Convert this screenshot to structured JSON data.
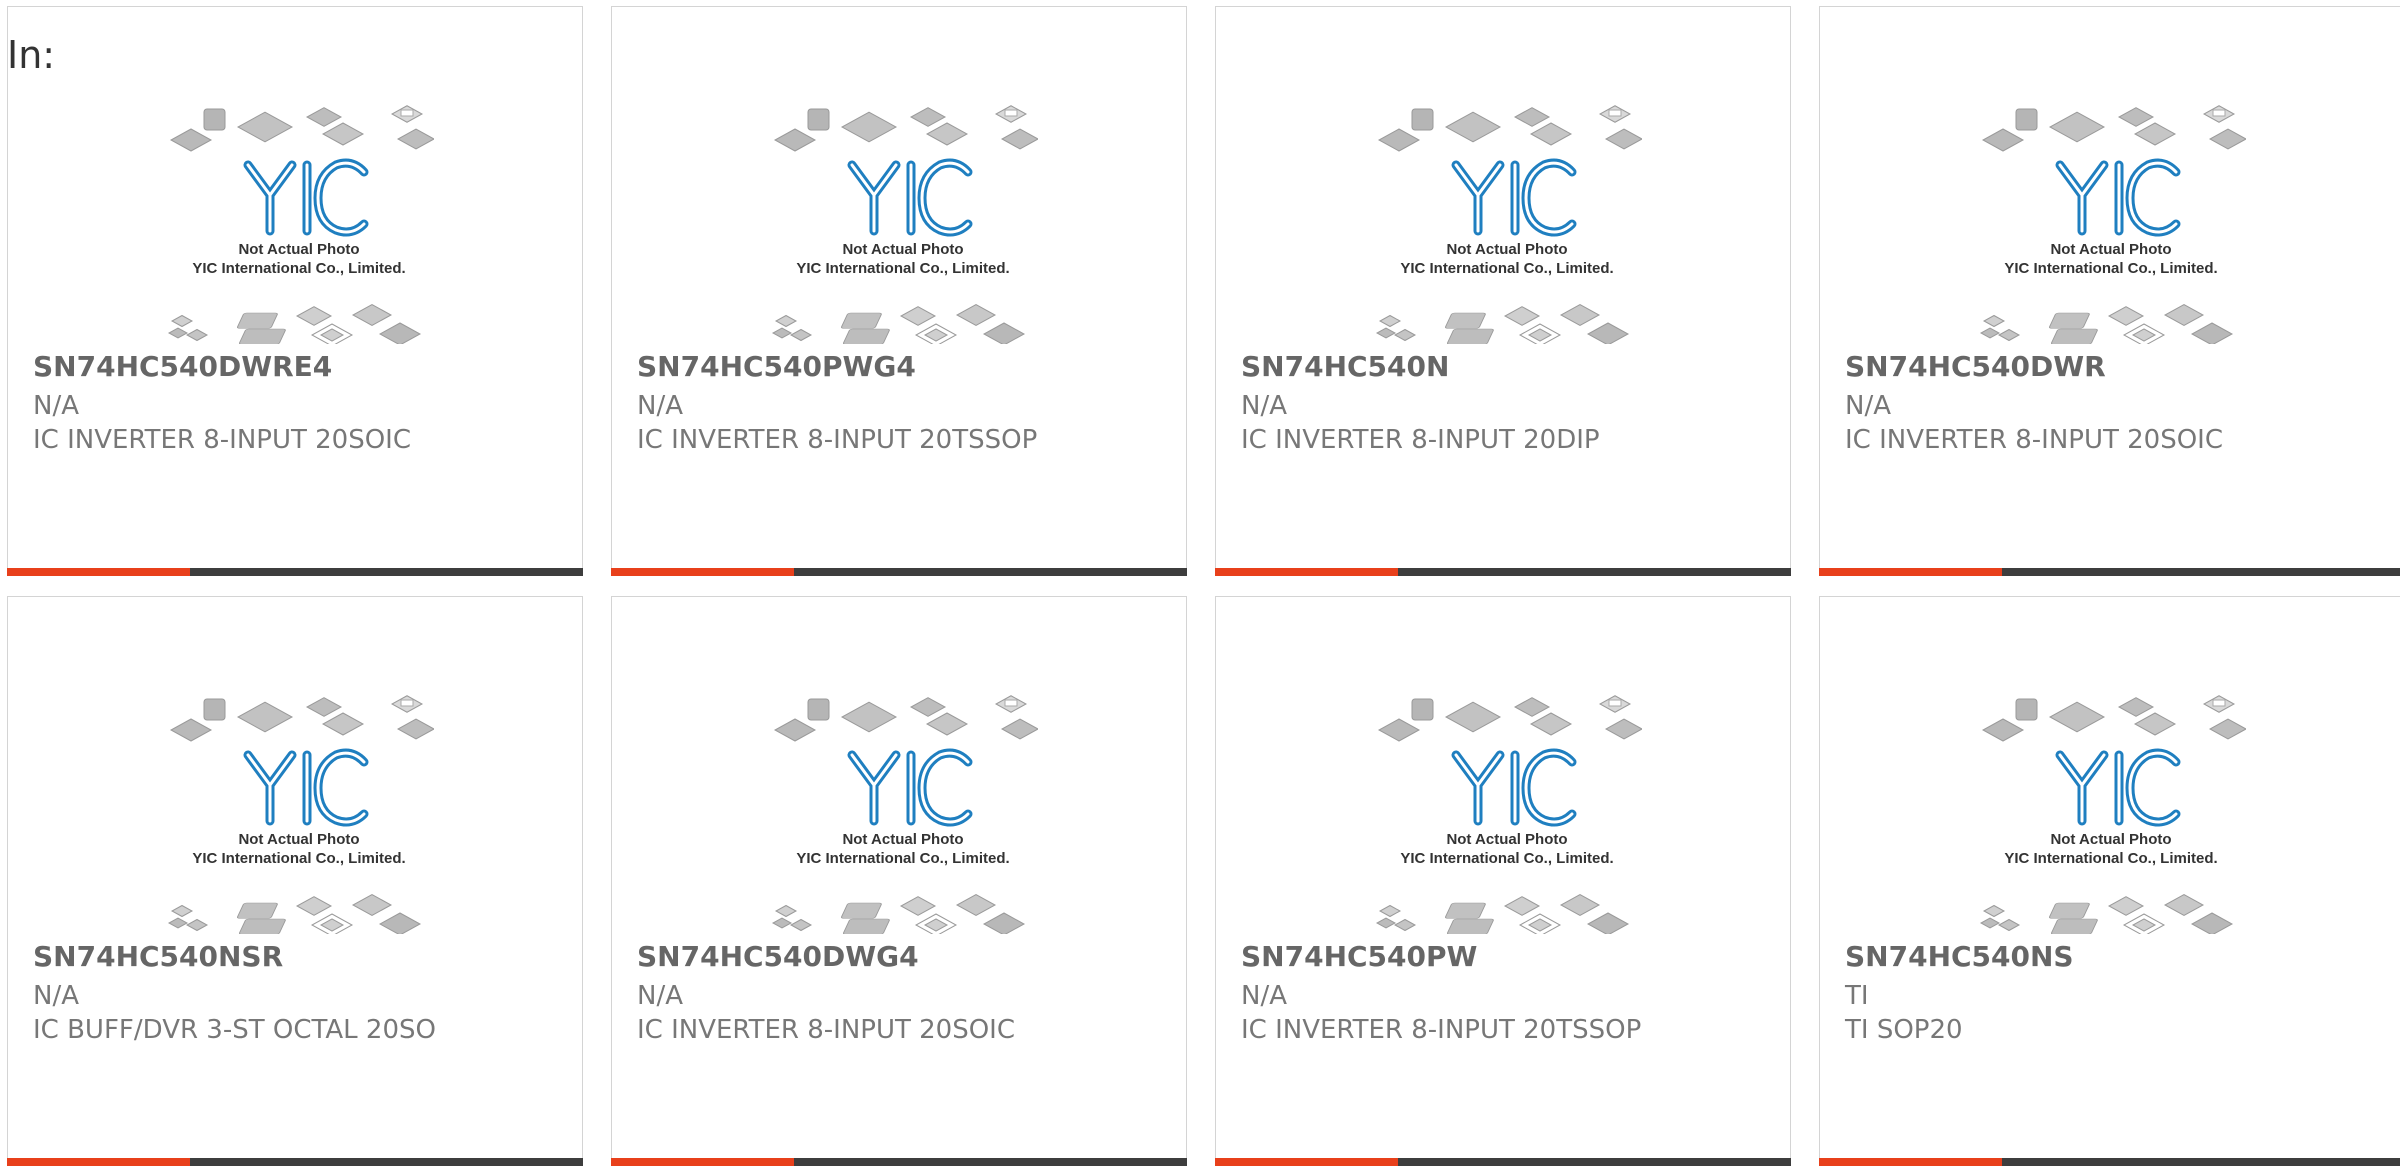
{
  "header": {
    "label": "In:"
  },
  "placeholder": {
    "line1": "Not Actual Photo",
    "line2": "YIC International Co., Limited.",
    "logo": "YIC"
  },
  "colors": {
    "accent": "#e8401b",
    "bar": "#3d3d3d",
    "logo_blue": "#1f7fc0"
  },
  "products": [
    {
      "part": "SN74HC540DWRE4",
      "maker": "N/A",
      "desc": "IC INVERTER 8-INPUT 20SOIC"
    },
    {
      "part": "SN74HC540PWG4",
      "maker": "N/A",
      "desc": "IC INVERTER 8-INPUT 20TSSOP"
    },
    {
      "part": "SN74HC540N",
      "maker": "N/A",
      "desc": "IC INVERTER 8-INPUT 20DIP"
    },
    {
      "part": "SN74HC540DWR",
      "maker": "N/A",
      "desc": "IC INVERTER 8-INPUT 20SOIC"
    },
    {
      "part": "SN74HC540NSR",
      "maker": "N/A",
      "desc": "IC BUFF/DVR 3-ST OCTAL 20SO"
    },
    {
      "part": "SN74HC540DWG4",
      "maker": "N/A",
      "desc": "IC INVERTER 8-INPUT 20SOIC"
    },
    {
      "part": "SN74HC540PW",
      "maker": "N/A",
      "desc": "IC INVERTER 8-INPUT 20TSSOP"
    },
    {
      "part": "SN74HC540NS",
      "maker": "TI",
      "desc": "TI SOP20"
    }
  ]
}
